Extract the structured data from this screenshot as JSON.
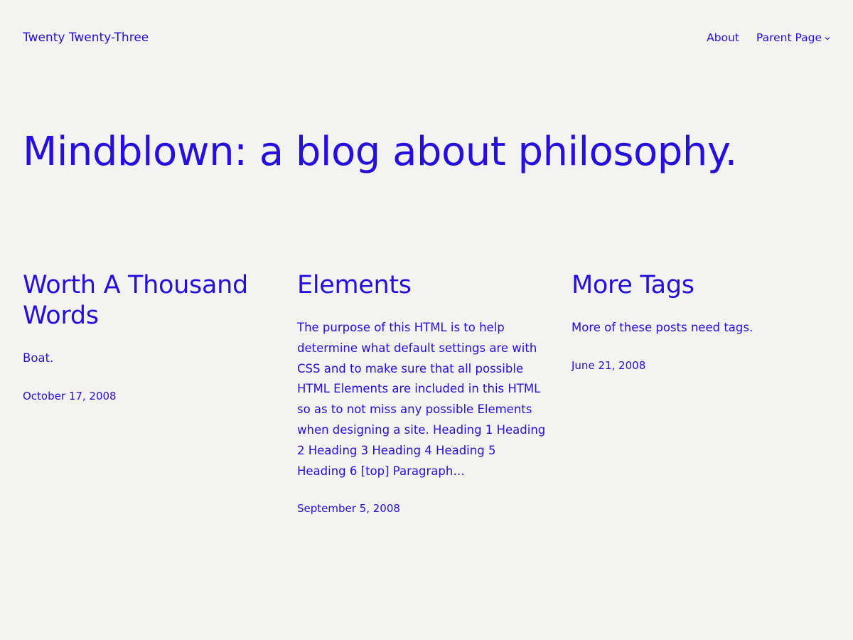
{
  "header": {
    "site_title": "Twenty Twenty-Three",
    "nav": [
      {
        "label": "About"
      },
      {
        "label": "Parent Page",
        "icon": "chevron-down-icon"
      }
    ]
  },
  "main": {
    "headline": "Mindblown: a blog about philosophy.",
    "posts": [
      {
        "title": "Worth A Thousand Words",
        "excerpt": "Boat.",
        "date": "October 17, 2008"
      },
      {
        "title": "Elements",
        "excerpt": "The purpose of this HTML is to help determine what default settings are with CSS and to make sure that all possible HTML Elements are included in this HTML so as to not miss any possible Elements when designing a site. Heading 1 Heading 2 Heading 3 Heading 4 Heading 5 Heading 6 [top] Paragraph…",
        "date": "September 5, 2008"
      },
      {
        "title": "More Tags",
        "excerpt": "More of these posts need tags.",
        "date": "June 21, 2008"
      }
    ]
  },
  "colors": {
    "background": "#f3f3f2",
    "accent": "#250fdc"
  }
}
